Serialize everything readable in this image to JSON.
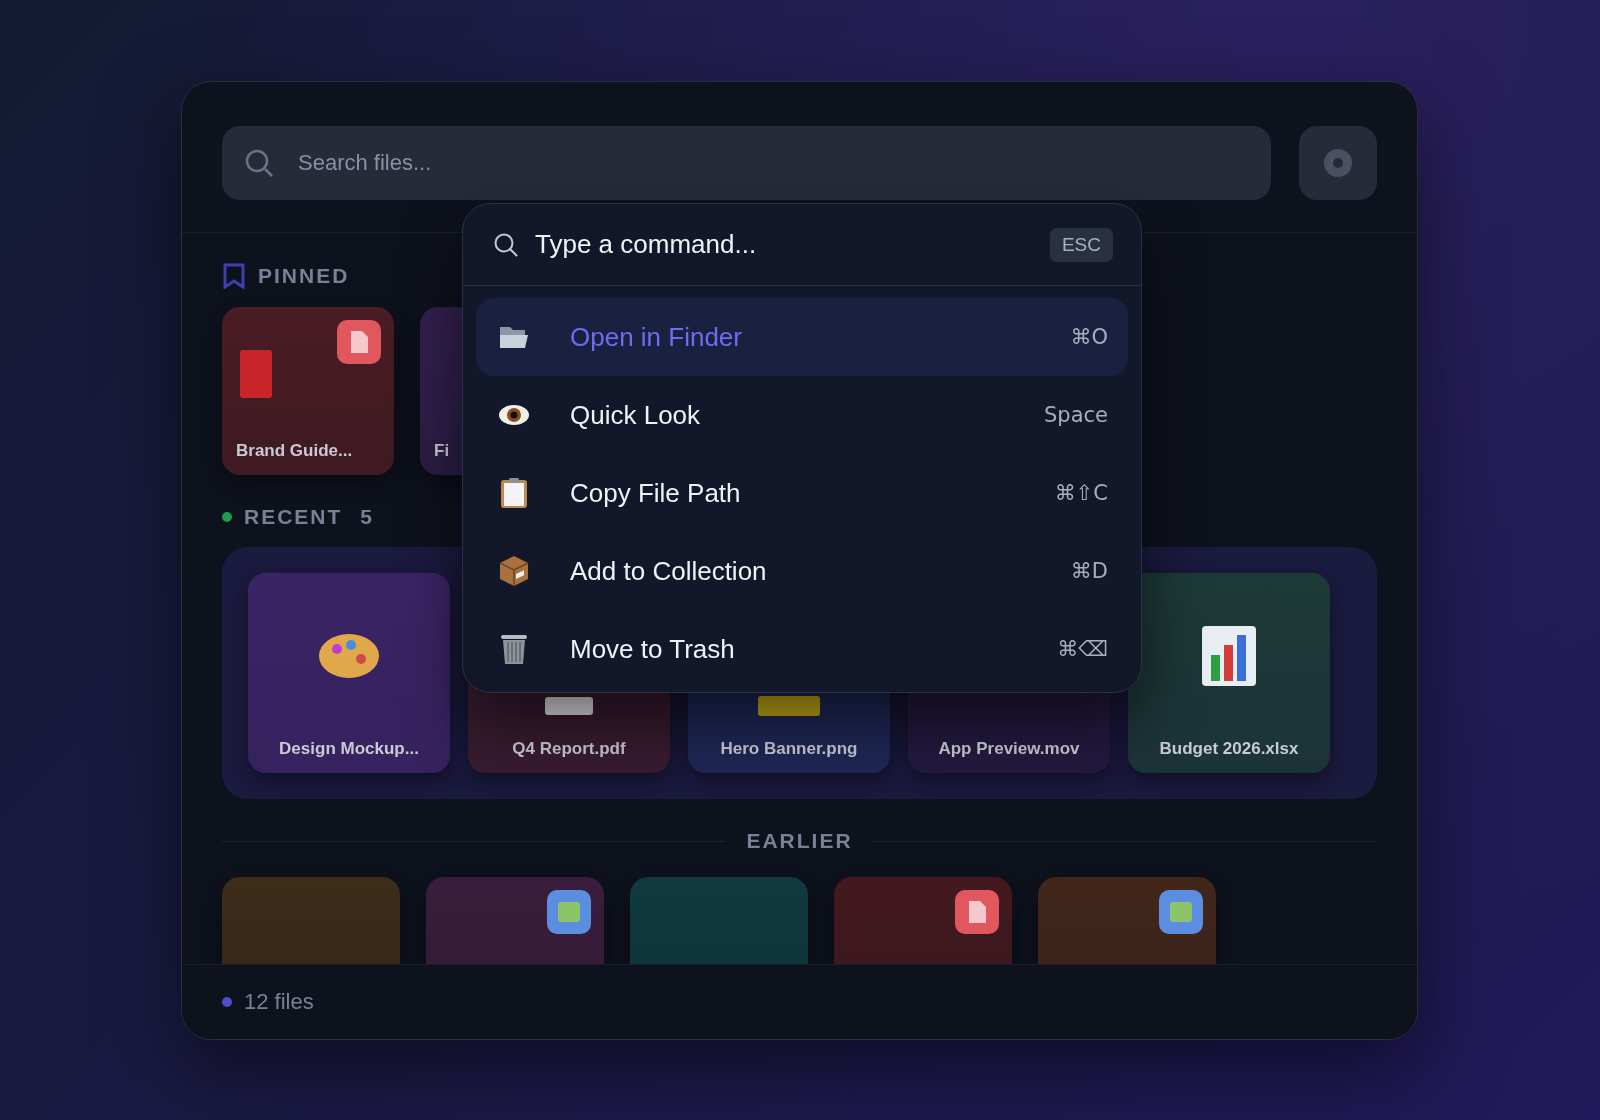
{
  "search": {
    "placeholder": "Search files..."
  },
  "pinned": {
    "label": "PINNED",
    "cards": [
      {
        "name": "Brand Guide...",
        "color": "#4a1c24"
      },
      {
        "name": "Fi",
        "color": "#33204f"
      }
    ]
  },
  "recent": {
    "label": "RECENT",
    "count": "5",
    "cards": [
      {
        "name": "Design Mockup...",
        "color": "#3b2466"
      },
      {
        "name": "Q4 Report.pdf",
        "color": "#3e1c2c"
      },
      {
        "name": "Hero Banner.png",
        "color": "#1f2a5a"
      },
      {
        "name": "App Preview.mov",
        "color": "#25193f"
      },
      {
        "name": "Budget 2026.xlsx",
        "color": "#1c3a36"
      }
    ]
  },
  "earlier": {
    "label": "EARLIER",
    "cards": [
      {
        "color": "#3d2c18"
      },
      {
        "color": "#3a1d3c"
      },
      {
        "color": "#0f3a40"
      },
      {
        "color": "#43191f"
      },
      {
        "color": "#42261a"
      }
    ]
  },
  "status_bar": {
    "text": "12 files"
  },
  "palette": {
    "placeholder": "Type a command...",
    "dismiss_key": "ESC",
    "commands": [
      {
        "label": "Open in Finder",
        "shortcut": "⌘O",
        "selected": true
      },
      {
        "label": "Quick Look",
        "shortcut": "Space",
        "selected": false
      },
      {
        "label": "Copy File Path",
        "shortcut": "⌘⇧C",
        "selected": false
      },
      {
        "label": "Add to Collection",
        "shortcut": "⌘D",
        "selected": false
      },
      {
        "label": "Move to Trash",
        "shortcut": "⌘⌫",
        "selected": false
      }
    ]
  }
}
